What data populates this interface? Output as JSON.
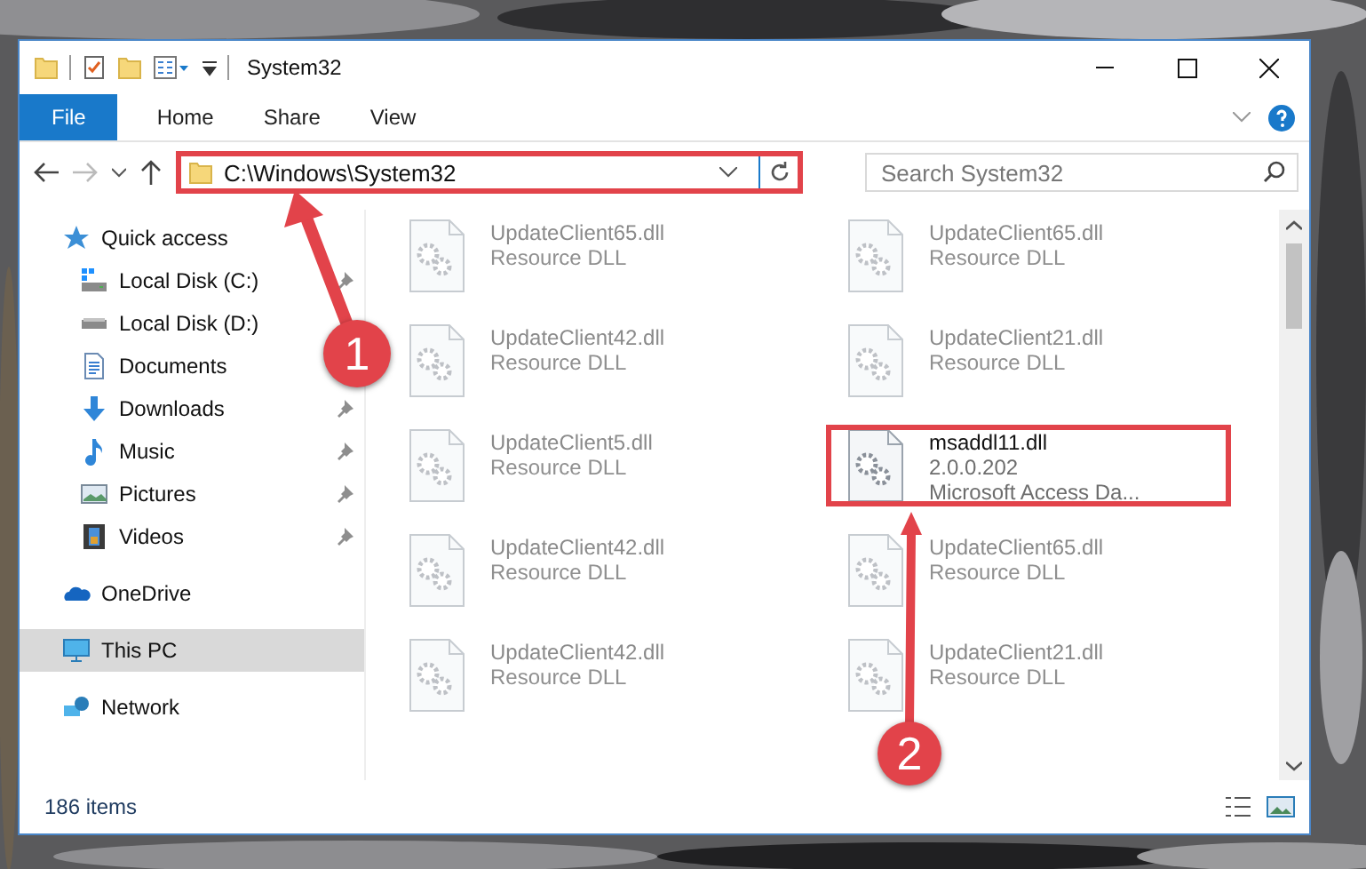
{
  "window": {
    "title": "System32"
  },
  "ribbon_tabs": [
    {
      "label": "File",
      "kind": "file",
      "selected": false
    },
    {
      "label": "Home",
      "kind": "tab",
      "selected": false
    },
    {
      "label": "Share",
      "kind": "tab",
      "selected": false
    },
    {
      "label": "View",
      "kind": "tab",
      "selected": false
    }
  ],
  "address": {
    "path": "C:\\Windows\\System32",
    "highlighted": true
  },
  "search": {
    "placeholder": "Search System32"
  },
  "nav": [
    {
      "label": "Quick access",
      "kind": "star",
      "pinned": false,
      "selected": false,
      "children": [
        {
          "label": "Local Disk (C:)",
          "kind": "drive-c",
          "pinned": true,
          "selected": false
        },
        {
          "label": "Local Disk (D:)",
          "kind": "drive",
          "pinned": false,
          "selected": false
        },
        {
          "label": "Documents",
          "kind": "document",
          "pinned": false,
          "selected": false
        },
        {
          "label": "Downloads",
          "kind": "download",
          "pinned": true,
          "selected": false
        },
        {
          "label": "Music",
          "kind": "music",
          "pinned": true,
          "selected": false
        },
        {
          "label": "Pictures",
          "kind": "pictures",
          "pinned": true,
          "selected": false
        },
        {
          "label": "Videos",
          "kind": "videos",
          "pinned": true,
          "selected": false
        }
      ]
    },
    {
      "label": "OneDrive",
      "kind": "cloud",
      "pinned": false,
      "selected": false
    },
    {
      "label": "This PC",
      "kind": "pc",
      "pinned": false,
      "selected": true
    },
    {
      "label": "Network",
      "kind": "network",
      "pinned": false,
      "selected": false
    }
  ],
  "files": [
    {
      "lines": [
        "UpdateClient65.dll",
        "Resource DLL"
      ],
      "blurred": true,
      "highlighted": false
    },
    {
      "lines": [
        "UpdateClient65.dll",
        "Resource DLL"
      ],
      "blurred": true,
      "highlighted": false
    },
    {
      "lines": [
        "UpdateClient42.dll",
        "Resource DLL"
      ],
      "blurred": true,
      "highlighted": false
    },
    {
      "lines": [
        "UpdateClient21.dll",
        "Resource DLL"
      ],
      "blurred": true,
      "highlighted": false
    },
    {
      "lines": [
        "UpdateClient5.dll",
        "Resource DLL"
      ],
      "blurred": true,
      "highlighted": false
    },
    {
      "lines": [
        "msaddl11.dll",
        "2.0.0.202",
        "Microsoft Access Da..."
      ],
      "blurred": false,
      "highlighted": true
    },
    {
      "lines": [
        "UpdateClient42.dll",
        "Resource DLL"
      ],
      "blurred": true,
      "highlighted": false
    },
    {
      "lines": [
        "UpdateClient65.dll",
        "Resource DLL"
      ],
      "blurred": true,
      "highlighted": false
    },
    {
      "lines": [
        "UpdateClient42.dll",
        "Resource DLL"
      ],
      "blurred": true,
      "highlighted": false
    },
    {
      "lines": [
        "UpdateClient21.dll",
        "Resource DLL"
      ],
      "blurred": true,
      "highlighted": false
    }
  ],
  "status_bar": {
    "count": "186 items"
  },
  "annotations": [
    {
      "number": "1"
    },
    {
      "number": "2"
    }
  ]
}
